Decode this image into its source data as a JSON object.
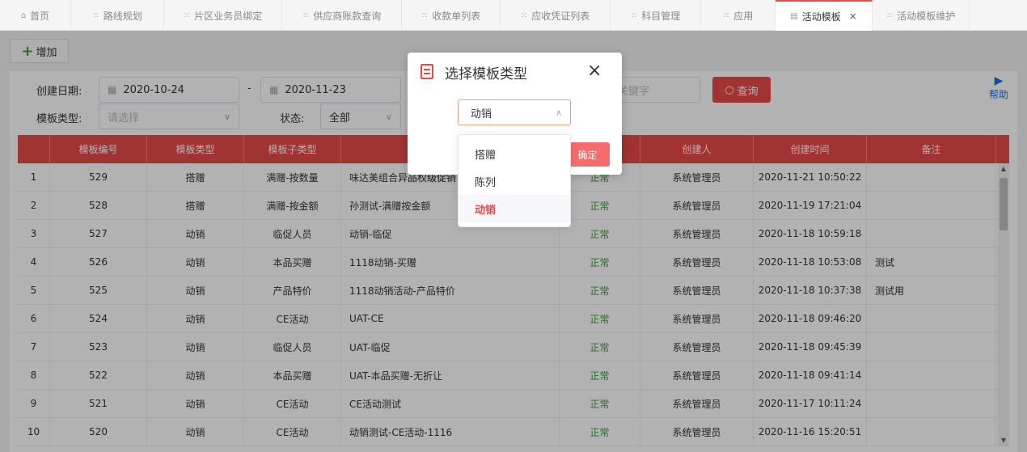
{
  "tabs": [
    {
      "label": "首页",
      "icon": "home-icon",
      "glyph": "⌂",
      "width": 88
    },
    {
      "label": "路线规划",
      "icon": "grid-icon",
      "glyph": "⁙",
      "width": 115
    },
    {
      "label": "片区业务员绑定",
      "icon": "grid-icon",
      "glyph": "⁙",
      "width": 146
    },
    {
      "label": "供应商账款查询",
      "icon": "grid-icon",
      "glyph": "⁙",
      "width": 148
    },
    {
      "label": "收款单列表",
      "icon": "grid-icon",
      "glyph": "⁙",
      "width": 122
    },
    {
      "label": "应收凭证列表",
      "icon": "grid-icon",
      "glyph": "⁙",
      "width": 136
    },
    {
      "label": "科目管理",
      "icon": "grid-icon",
      "glyph": "⁙",
      "width": 112
    },
    {
      "label": "应用",
      "icon": "grid-icon",
      "glyph": "⁙",
      "width": 92
    },
    {
      "label": "活动模板",
      "icon": "document-icon",
      "glyph": "▤",
      "width": 120,
      "active": true,
      "closable": true
    },
    {
      "label": "活动模板维护",
      "icon": "grid-icon",
      "glyph": "⁙",
      "width": 120
    }
  ],
  "toolbar": {
    "add_label": "增加"
  },
  "filters": {
    "create_date_label": "创建日期:",
    "date_start": "2020-10-24",
    "date_end": "2020-11-23",
    "date_separator": "-",
    "template_type_label": "模板类型:",
    "template_type_placeholder": "请选择",
    "status_label": "状态:",
    "status_value": "全部",
    "keyword_placeholder": "入关键字",
    "query_label": "查询",
    "help_label": "帮助"
  },
  "table": {
    "headers": [
      "",
      "模板编号",
      "模板类型",
      "模板子类型",
      "",
      "",
      "创建人",
      "创建时间",
      "备注"
    ],
    "rows": [
      [
        "1",
        "529",
        "搭赠",
        "满赠-按数量",
        "味达美组合异品权级促销",
        "正常",
        "系统管理员",
        "2020-11-21 10:50:22",
        ""
      ],
      [
        "2",
        "528",
        "搭赠",
        "满赠-按金额",
        "孙测试-满赠按金额",
        "正常",
        "系统管理员",
        "2020-11-19 17:21:04",
        ""
      ],
      [
        "3",
        "527",
        "动销",
        "临促人员",
        "动销-临促",
        "正常",
        "系统管理员",
        "2020-11-18 10:59:18",
        ""
      ],
      [
        "4",
        "526",
        "动销",
        "本品买赠",
        "1118动销-买赠",
        "正常",
        "系统管理员",
        "2020-11-18 10:53:08",
        "测试"
      ],
      [
        "5",
        "525",
        "动销",
        "产品特价",
        "1118动销活动-产品特价",
        "正常",
        "系统管理员",
        "2020-11-18 10:37:38",
        "测试用"
      ],
      [
        "6",
        "524",
        "动销",
        "CE活动",
        "UAT-CE",
        "正常",
        "系统管理员",
        "2020-11-18 09:46:20",
        ""
      ],
      [
        "7",
        "523",
        "动销",
        "临促人员",
        "UAT-临促",
        "正常",
        "系统管理员",
        "2020-11-18 09:45:39",
        ""
      ],
      [
        "8",
        "522",
        "动销",
        "本品买赠",
        "UAT-本品买赠-无折让",
        "正常",
        "系统管理员",
        "2020-11-18 09:41:14",
        ""
      ],
      [
        "9",
        "521",
        "动销",
        "CE活动",
        "CE活动测试",
        "正常",
        "系统管理员",
        "2020-11-17 10:11:24",
        ""
      ],
      [
        "10",
        "520",
        "动销",
        "CE活动",
        "动销测试-CE活动-1116",
        "正常",
        "系统管理员",
        "2020-11-16 15:20:51",
        ""
      ]
    ]
  },
  "dialog": {
    "title": "选择模板类型",
    "close": "×",
    "selected_value": "动销",
    "confirm_label": "确定",
    "options": [
      "搭赠",
      "陈列",
      "动销"
    ],
    "selected_index": 2
  },
  "colors": {
    "accent": "#e84a4a",
    "status_ok": "#3a9c3a",
    "help": "#1e6fd9"
  }
}
